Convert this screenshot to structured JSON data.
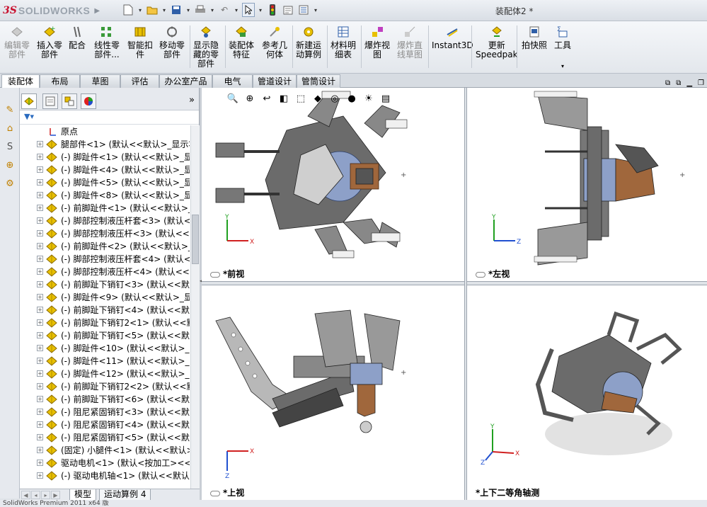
{
  "app": {
    "logo_ds": "3S",
    "logo_name": "SOLIDWORKS",
    "doc_title": "装配体2 *"
  },
  "quick_toolbar": [
    "new-icon",
    "open-icon",
    "save-icon",
    "print-icon",
    "undo-icon",
    "select-icon",
    "rebuild-icon",
    "file-properties-icon",
    "options-icon"
  ],
  "commands": [
    {
      "label": "编辑零\n部件",
      "disabled": true
    },
    {
      "label": "插入零\n部件"
    },
    {
      "label": "配合"
    },
    {
      "label": "线性零\n部件..."
    },
    {
      "label": "智能扣\n件"
    },
    {
      "label": "移动零\n部件"
    },
    {
      "label": "显示隐\n藏的零\n部件"
    },
    {
      "label": "装配体\n特征"
    },
    {
      "label": "参考几\n何体"
    },
    {
      "label": "新建运\n动算例"
    },
    {
      "label": "材料明\n细表"
    },
    {
      "label": "爆炸视\n图"
    },
    {
      "label": "爆炸直\n线草图",
      "disabled": true
    },
    {
      "label": "Instant3D"
    },
    {
      "label": "更新\nSpeedpak"
    },
    {
      "label": "拍快照"
    },
    {
      "label": "工具"
    }
  ],
  "tabs": [
    "装配体",
    "布局",
    "草图",
    "评估",
    "办公室产品",
    "电气",
    "管道设计",
    "管筒设计"
  ],
  "active_tab": "装配体",
  "tree": [
    {
      "text": "原点",
      "type": "origin"
    },
    {
      "text": "腿部件<1> (默认<<默认>_显示状"
    },
    {
      "text": "(-) 脚趾件<1> (默认<<默认>_显"
    },
    {
      "text": "(-) 脚趾件<4> (默认<<默认>_显"
    },
    {
      "text": "(-) 脚趾件<5> (默认<<默认>_显"
    },
    {
      "text": "(-) 脚趾件<8> (默认<<默认>_显"
    },
    {
      "text": "(-) 前脚趾件<1> (默认<<默认>_"
    },
    {
      "text": "(-) 脚部控制液压杆套<3> (默认<"
    },
    {
      "text": "(-) 脚部控制液压杆<3> (默认<<"
    },
    {
      "text": "(-) 前脚趾件<2> (默认<<默认>_"
    },
    {
      "text": "(-) 脚部控制液压杆套<4> (默认<"
    },
    {
      "text": "(-) 脚部控制液压杆<4> (默认<<"
    },
    {
      "text": "(-) 前脚趾下销钉<3> (默认<<默"
    },
    {
      "text": "(-) 脚趾件<9> (默认<<默认>_显"
    },
    {
      "text": "(-) 前脚趾下销钉<4> (默认<<默"
    },
    {
      "text": "(-) 前脚趾下销钉2<1> (默认<<默"
    },
    {
      "text": "(-) 前脚趾下销钉<5> (默认<<默"
    },
    {
      "text": "(-) 脚趾件<10> (默认<<默认>_显"
    },
    {
      "text": "(-) 脚趾件<11> (默认<<默认>_显"
    },
    {
      "text": "(-) 脚趾件<12> (默认<<默认>_显"
    },
    {
      "text": "(-) 前脚趾下销钉2<2> (默认<<默"
    },
    {
      "text": "(-) 前脚趾下销钉<6> (默认<<默"
    },
    {
      "text": "(-) 阻尼紧固销钉<3> (默认<<默"
    },
    {
      "text": "(-) 阻尼紧固销钉<4> (默认<<默"
    },
    {
      "text": "(-) 阻尼紧固销钉<5> (默认<<默"
    },
    {
      "text": "(固定) 小腿件<1> (默认<<默认>"
    },
    {
      "text": "驱动电机<1> (默认<按加工><<"
    },
    {
      "text": "(-) 驱动电机轴<1> (默认<<默认>"
    }
  ],
  "bottom_tabs": [
    "模型",
    "运动算例 4"
  ],
  "status": "SolidWorks Premium 2011 x64 版",
  "views": {
    "front": "*前视",
    "left": "*左视",
    "top": "*上视",
    "iso": "*上下二等角轴测"
  },
  "axes": {
    "x": "X",
    "y": "Y",
    "z": "Z"
  },
  "colors": {
    "accent": "#c8102e",
    "part_icon": "#e8c000",
    "triad_x": "#d02020",
    "triad_y": "#20a020",
    "triad_z": "#2050d0"
  }
}
